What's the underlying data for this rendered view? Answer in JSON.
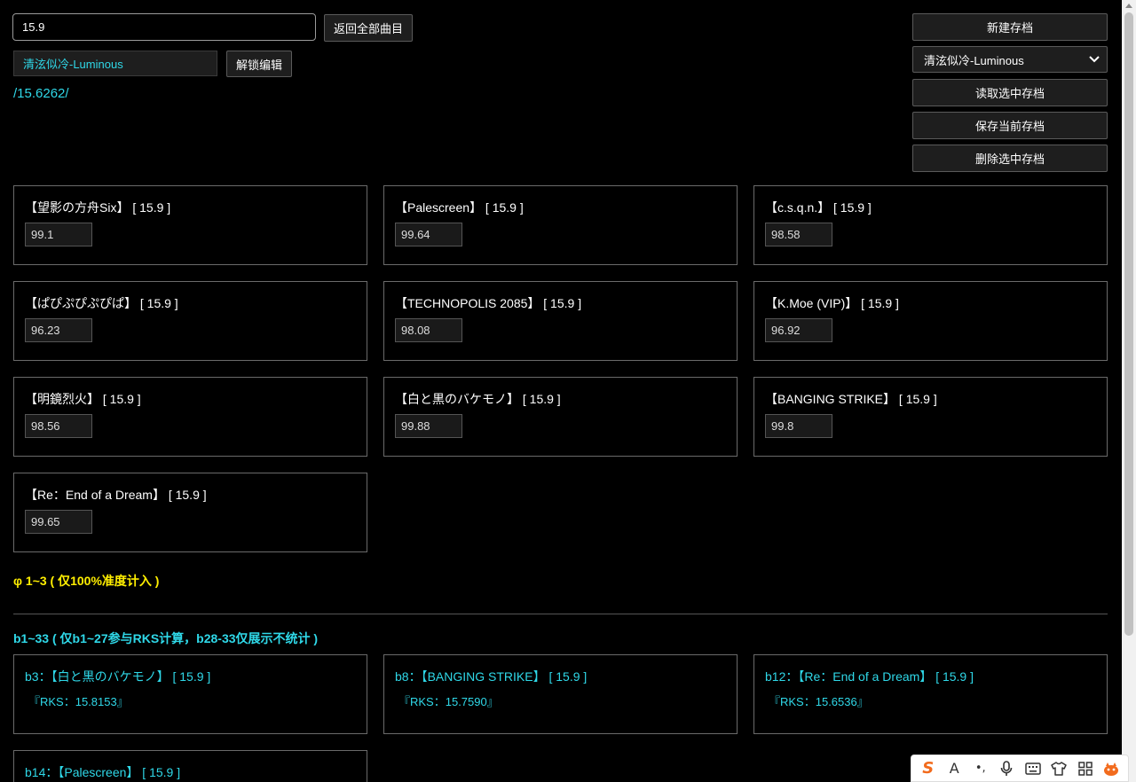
{
  "search": {
    "value": "15.9"
  },
  "toolbar": {
    "back_label": "返回全部曲目",
    "unlock_label": "解锁编辑"
  },
  "player": {
    "name": "清泫似冷-Luminous"
  },
  "average": {
    "text": "/15.6262/"
  },
  "saves": {
    "new_label": "新建存档",
    "selected": "清泫似冷-Luminous",
    "load_label": "读取选中存档",
    "save_label": "保存当前存档",
    "delete_label": "删除选中存档"
  },
  "songs": [
    {
      "title": "【望影の方舟Six】 [ 15.9 ]",
      "acc": "99.1"
    },
    {
      "title": "【Palescreen】 [ 15.9 ]",
      "acc": "99.64"
    },
    {
      "title": "【c.s.q.n.】 [ 15.9 ]",
      "acc": "98.58"
    },
    {
      "title": "【ぱぴぷぴぷぴぱ】 [ 15.9 ]",
      "acc": "96.23"
    },
    {
      "title": "【TECHNOPOLIS 2085】 [ 15.9 ]",
      "acc": "98.08"
    },
    {
      "title": "【K.Moe (VIP)】 [ 15.9 ]",
      "acc": "96.92"
    },
    {
      "title": "【明鏡烈火】 [ 15.9 ]",
      "acc": "98.56"
    },
    {
      "title": "【白と黒のバケモノ】 [ 15.9 ]",
      "acc": "99.88"
    },
    {
      "title": "【BANGING STRIKE】 [ 15.9 ]",
      "acc": "99.8"
    },
    {
      "title": "【Re：End of a Dream】 [ 15.9 ]",
      "acc": "99.65"
    }
  ],
  "phi_section": {
    "heading": "φ 1~3 ( 仅100%准度计入 )"
  },
  "best_section": {
    "heading": "b1~33 ( 仅b1~27参与RKS计算，b28-33仅展示不统计 )",
    "items": [
      {
        "title": "b3：【白と黒のバケモノ】 [ 15.9 ]",
        "rks": "『RKS：15.8153』"
      },
      {
        "title": "b8：【BANGING STRIKE】 [ 15.9 ]",
        "rks": "『RKS：15.7590』"
      },
      {
        "title": "b12：【Re：End of a Dream】 [ 15.9 ]",
        "rks": "『RKS：15.6536』"
      },
      {
        "title": "b14：【Palescreen】 [ 15.9 ]",
        "rks": ""
      }
    ]
  },
  "ime": {
    "logo": "S",
    "font": "A",
    "punct": "•,",
    "mic": "mic-icon",
    "keyboard": "keyboard-icon",
    "skin": "shirt-icon",
    "apps": "grid-icon"
  }
}
